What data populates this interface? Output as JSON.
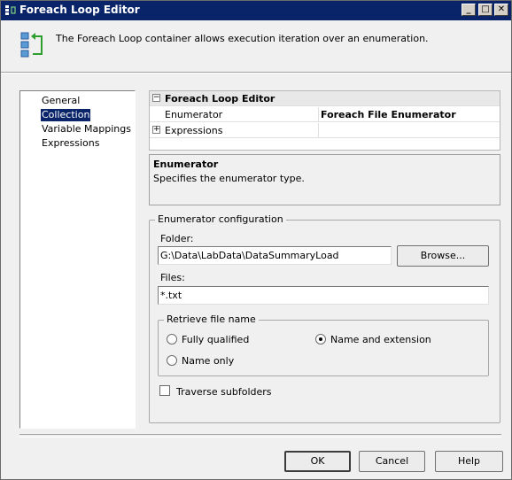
{
  "window": {
    "title": "Foreach Loop Editor"
  },
  "header": {
    "description": "The Foreach Loop container allows execution iteration over an enumeration."
  },
  "nav": {
    "items": [
      {
        "label": "General"
      },
      {
        "label": "Collection"
      },
      {
        "label": "Variable Mappings"
      },
      {
        "label": "Expressions"
      }
    ],
    "selected": "Collection"
  },
  "propgrid": {
    "category": "Foreach Loop Editor",
    "enumerator_label": "Enumerator",
    "enumerator_value": "Foreach File Enumerator",
    "expressions_label": "Expressions",
    "expressions_value": ""
  },
  "description_box": {
    "title": "Enumerator",
    "text": "Specifies the enumerator type."
  },
  "config": {
    "legend": "Enumerator configuration",
    "folder_label": "Folder:",
    "folder_value": "G:\\Data\\LabData\\DataSummaryLoad",
    "browse_label": "Browse...",
    "files_label": "Files:",
    "files_value": "*.txt",
    "retrieve": {
      "legend": "Retrieve file name",
      "options": [
        {
          "label": "Fully qualified",
          "checked": false
        },
        {
          "label": "Name and extension",
          "checked": true
        },
        {
          "label": "Name only",
          "checked": false
        }
      ]
    },
    "traverse_label": "Traverse subfolders",
    "traverse_checked": false
  },
  "buttons": {
    "ok": "OK",
    "cancel": "Cancel",
    "help": "Help"
  },
  "titlebar_buttons": {
    "minimize": "_",
    "maximize": "□",
    "close": "✕"
  },
  "colors": {
    "title_bar": "#0a246a",
    "selection": "#0a246a"
  }
}
